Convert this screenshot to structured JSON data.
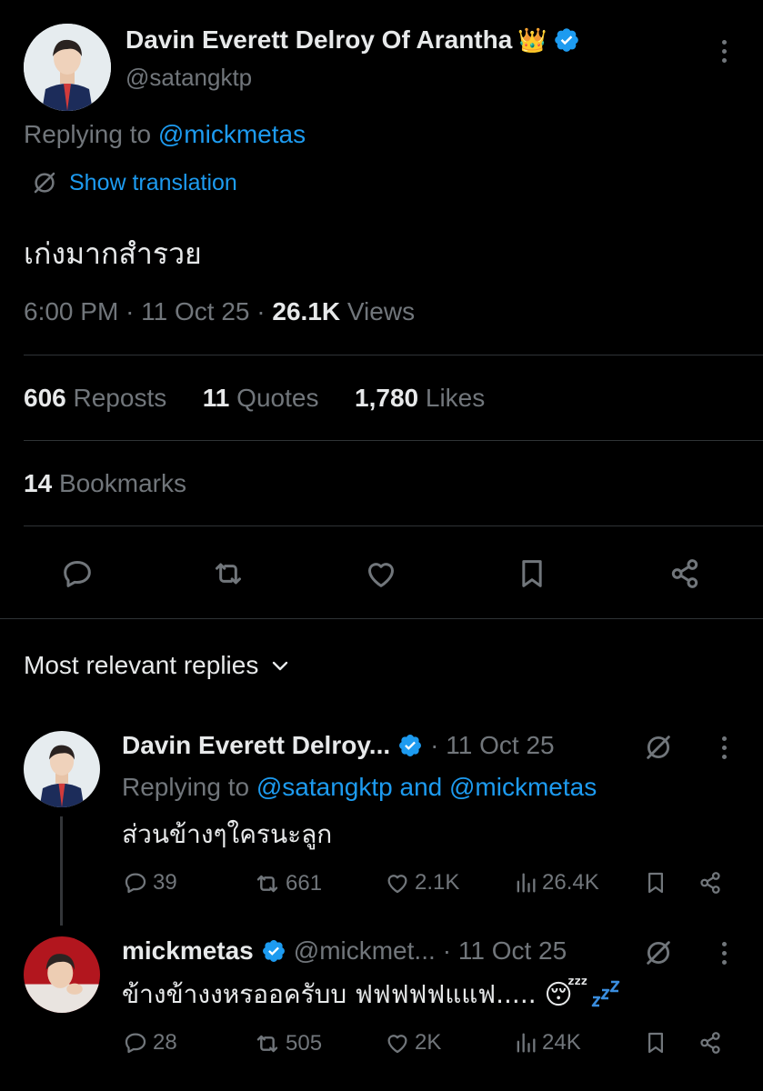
{
  "tweet": {
    "author_name": "Davin Everett Delroy Of Arantha",
    "author_emoji": "👑",
    "handle": "@satangktp",
    "replying_prefix": "Replying to",
    "replying_to": "@mickmetas",
    "translate_label": "Show translation",
    "text": "เก่งมากสำรวย",
    "time": "6:00 PM",
    "date": "11 Oct 25",
    "views_count": "26.1K",
    "views_label": "Views",
    "reposts_count": "606",
    "reposts_label": "Reposts",
    "quotes_count": "11",
    "quotes_label": "Quotes",
    "likes_count": "1,780",
    "likes_label": "Likes",
    "bookmarks_count": "14",
    "bookmarks_label": "Bookmarks"
  },
  "replies_header": "Most relevant replies",
  "replies": [
    {
      "name": "Davin Everett Delroy...",
      "date": "· 11 Oct 25",
      "replying_prefix": "Replying to",
      "replying_1": "@satangktp",
      "replying_and": "and",
      "replying_2": "@mickmetas",
      "text": "ส่วนข้างๆใครนะลูก",
      "comments": "39",
      "reposts": "661",
      "likes": "2.1K",
      "views": "26.4K"
    },
    {
      "name": "mickmetas",
      "handle": "@mickmet...",
      "date": "· 11 Oct 25",
      "text": "ข้างข้างงหรออครับบ ฟฟฟฟฟแแฟ..... ",
      "emoji": "😴",
      "comments": "28",
      "reposts": "505",
      "likes": "2K",
      "views": "24K"
    }
  ],
  "colors": {
    "background": "#000000",
    "text": "#e7e9ea",
    "muted": "#71767b",
    "accent": "#1d9bf0",
    "divider": "#2f3336"
  },
  "icons": [
    "verified-badge-icon",
    "more-icon",
    "globe-translate-icon",
    "reply-icon",
    "repost-icon",
    "like-icon",
    "bookmark-icon",
    "share-icon",
    "chevron-down-icon",
    "views-icon",
    "grok-icon"
  ]
}
